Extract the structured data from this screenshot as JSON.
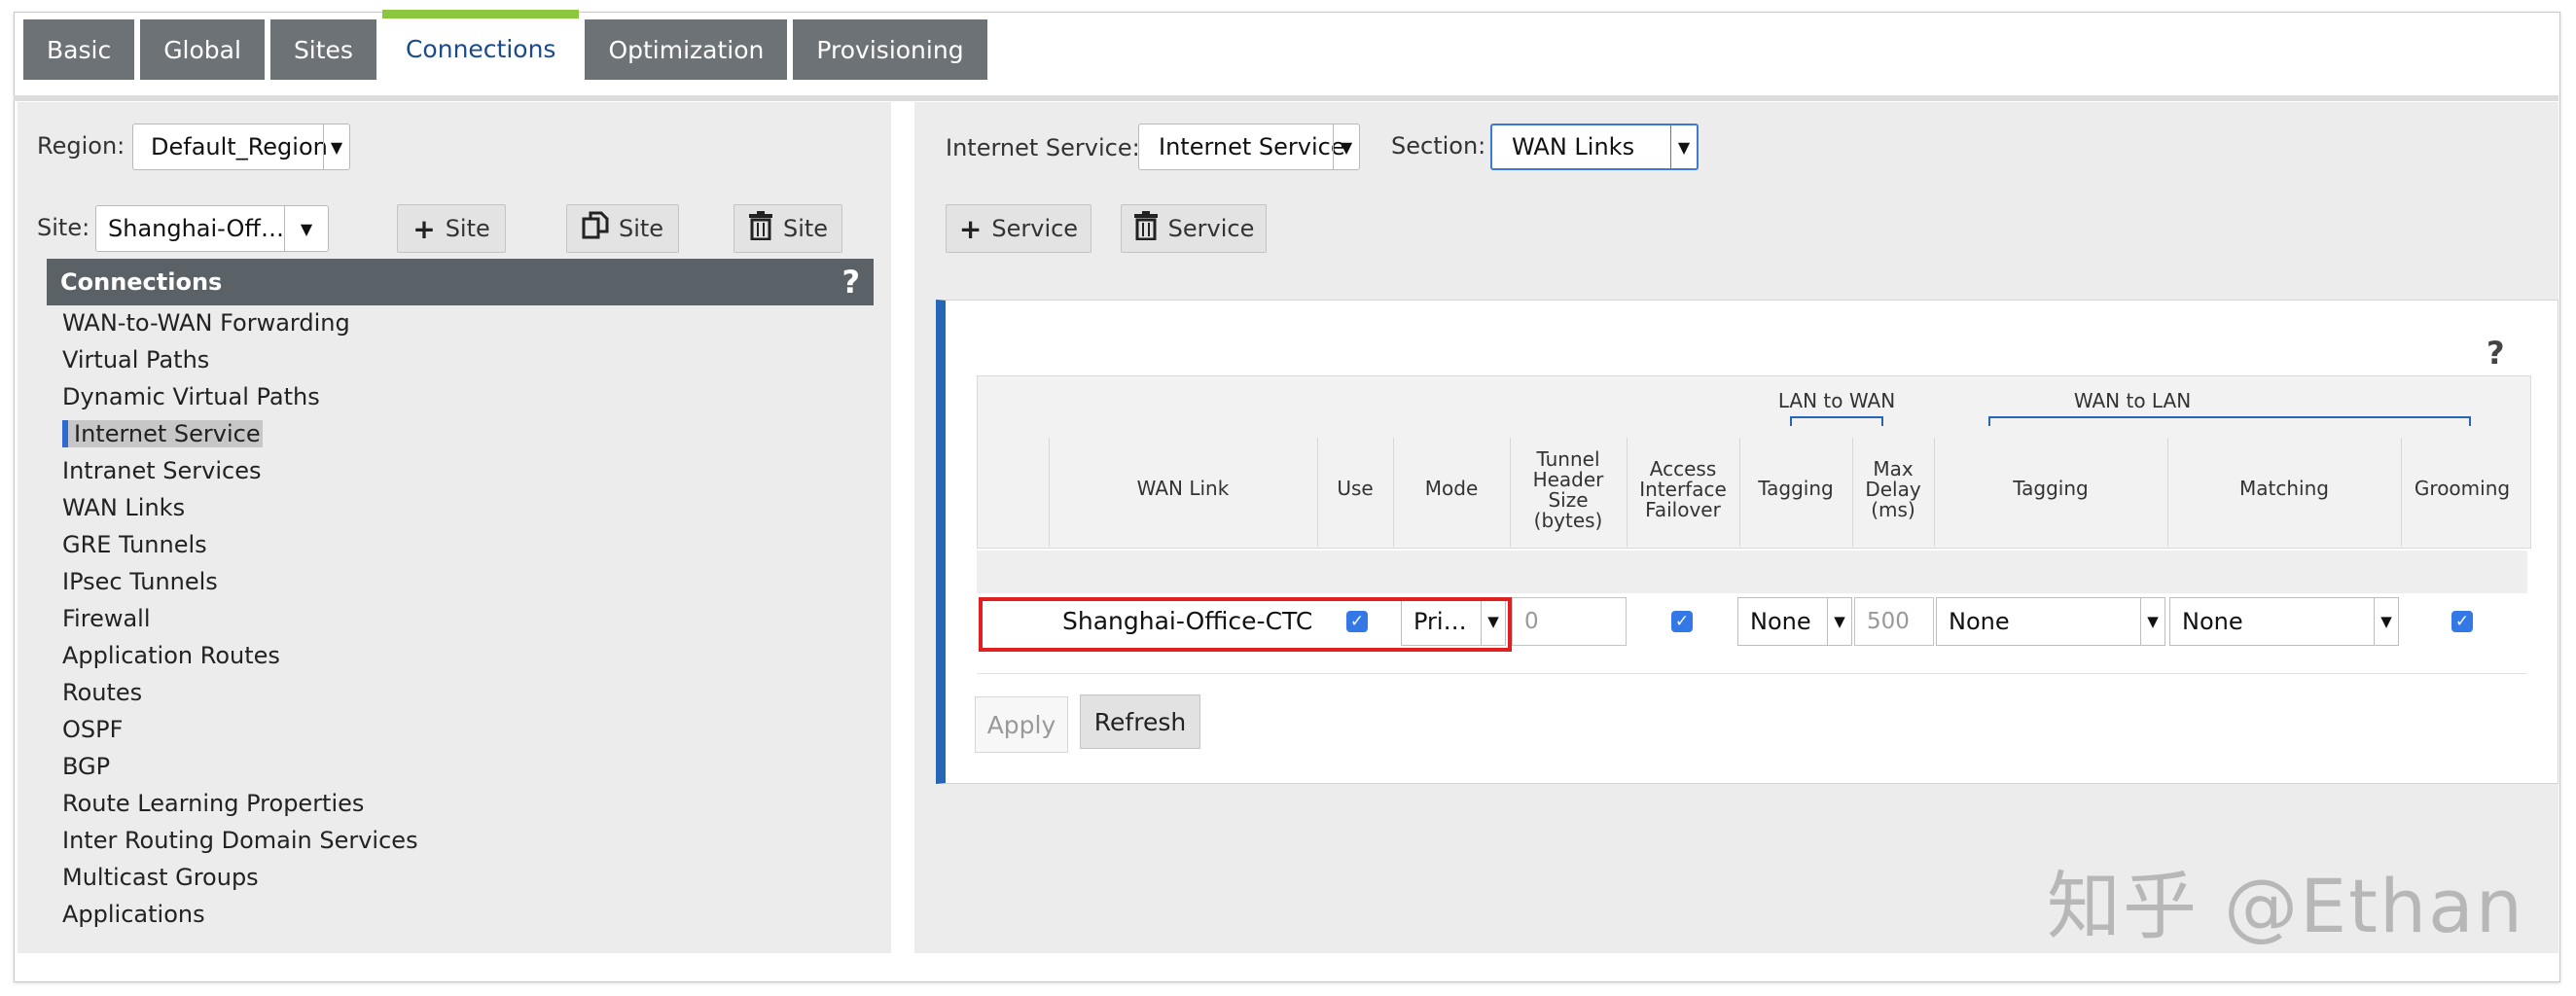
{
  "tabs": [
    {
      "label": "Basic",
      "active": false
    },
    {
      "label": "Global",
      "active": false
    },
    {
      "label": "Sites",
      "active": false
    },
    {
      "label": "Connections",
      "active": true
    },
    {
      "label": "Optimization",
      "active": false
    },
    {
      "label": "Provisioning",
      "active": false
    }
  ],
  "left": {
    "region_label": "Region:",
    "region_value": "Default_Region",
    "site_label": "Site:",
    "site_value": "Shanghai-Off…",
    "buttons": {
      "add_site": "Site",
      "copy_site": "Site",
      "delete_site": "Site"
    },
    "connections_title": "Connections",
    "help": "?",
    "nav": [
      "WAN-to-WAN Forwarding",
      "Virtual Paths",
      "Dynamic Virtual Paths",
      "Internet Service",
      "Intranet Services",
      "WAN Links",
      "GRE Tunnels",
      "IPsec Tunnels",
      "Firewall",
      "Application Routes",
      "Routes",
      "OSPF",
      "BGP",
      "Route Learning Properties",
      "Inter Routing Domain Services",
      "Multicast Groups",
      "Applications"
    ],
    "selected_nav": "Internet Service"
  },
  "right": {
    "internet_service_label": "Internet Service:",
    "internet_service_value": "Internet Service",
    "section_label": "Section:",
    "section_value": "WAN Links",
    "add_service": "Service",
    "delete_service": "Service",
    "help": "?",
    "groups": {
      "lan_to_wan": "LAN to WAN",
      "wan_to_lan": "WAN to LAN"
    },
    "columns": {
      "wan_link": "WAN Link",
      "use": "Use",
      "mode": "Mode",
      "tunnel_header": [
        "Tunnel",
        "Header",
        "Size",
        "(bytes)"
      ],
      "access_failover": [
        "Access",
        "Interface",
        "Failover"
      ],
      "tagging_l2w": "Tagging",
      "max_delay": [
        "Max",
        "Delay",
        "(ms)"
      ],
      "tagging_w2l": "Tagging",
      "matching": "Matching",
      "grooming": "Grooming"
    },
    "row": {
      "wan_link": "Shanghai-Office-CTC",
      "use": true,
      "mode": "Pri…",
      "tunnel_header": "0",
      "access_failover": true,
      "tagging_l2w": "None",
      "max_delay": "500",
      "tagging_w2l": "None",
      "matching": "None",
      "grooming": true
    },
    "apply": "Apply",
    "refresh": "Refresh"
  },
  "watermark": "知乎 @Ethan",
  "colors": {
    "accent_blue": "#2566b5",
    "tab_active_green": "#8cc63f",
    "highlight_red": "#e02020",
    "header_gray": "#5a6268"
  }
}
